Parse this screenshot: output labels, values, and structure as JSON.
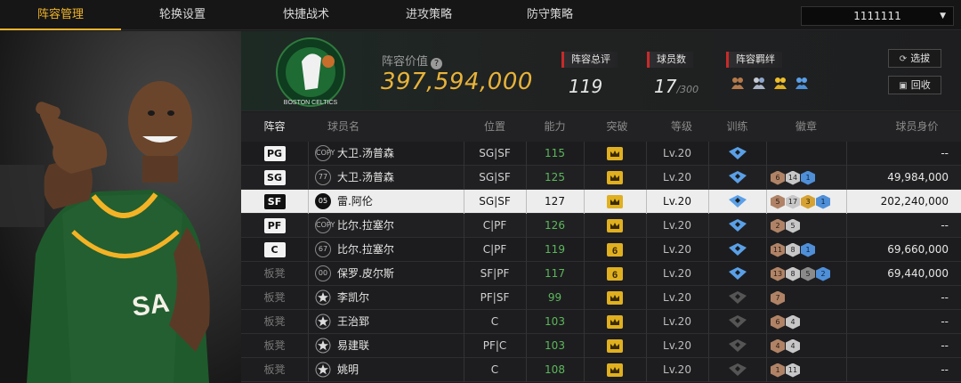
{
  "nav": {
    "tabs": [
      "阵容管理",
      "轮换设置",
      "快捷战术",
      "进攻策略",
      "防守策略"
    ],
    "active_index": 0,
    "account_select": "1111111"
  },
  "summary": {
    "value_label": "阵容价值",
    "value": "397,594,000",
    "overall_label": "阵容总评",
    "overall": "119",
    "players_label": "球员数",
    "players_count": "17",
    "players_max": "/300",
    "bond_label": "阵容羁绊",
    "bond_icons": [
      "bond-bronze-icon",
      "bond-silver-icon",
      "bond-gold-icon",
      "bond-blue-icon"
    ],
    "team_logo_text": "BOSTON CELTICS",
    "btn_select": "选拔",
    "btn_recycle": "回收"
  },
  "table": {
    "headers": [
      "阵容",
      "球员名",
      "位置",
      "能力",
      "突破",
      "等级",
      "训练",
      "徽章",
      "球员身价"
    ],
    "rows": [
      {
        "slot": "PG",
        "slot_type": "starter",
        "num": "COPY",
        "name": "大卫.汤普森",
        "pos": "SG|SF",
        "ability": "115",
        "breakthrough": "crown",
        "level": "Lv.20",
        "train": "blue",
        "badges": [],
        "price": "--"
      },
      {
        "slot": "SG",
        "slot_type": "starter",
        "num": "77",
        "name": "大卫.汤普森",
        "pos": "SG|SF",
        "ability": "125",
        "breakthrough": "crown",
        "level": "Lv.20",
        "train": "blue",
        "badges": [
          {
            "c": "bronze",
            "v": "6"
          },
          {
            "c": "silver",
            "v": "14"
          },
          {
            "c": "blue",
            "v": "1"
          }
        ],
        "price": "49,984,000"
      },
      {
        "slot": "SF",
        "slot_type": "starter",
        "num": "05",
        "name": "雷.阿伦",
        "pos": "SG|SF",
        "ability": "127",
        "breakthrough": "crown",
        "level": "Lv.20",
        "train": "blue",
        "badges": [
          {
            "c": "bronze",
            "v": "5"
          },
          {
            "c": "silver",
            "v": "17"
          },
          {
            "c": "gold",
            "v": "3"
          },
          {
            "c": "blue",
            "v": "1"
          }
        ],
        "price": "202,240,000",
        "selected": true
      },
      {
        "slot": "PF",
        "slot_type": "starter",
        "num": "COPY",
        "name": "比尔.拉塞尔",
        "pos": "C|PF",
        "ability": "126",
        "breakthrough": "crown",
        "level": "Lv.20",
        "train": "blue",
        "badges": [
          {
            "c": "bronze",
            "v": "2"
          },
          {
            "c": "silver",
            "v": "5"
          }
        ],
        "price": "--"
      },
      {
        "slot": "C",
        "slot_type": "starter",
        "num": "67",
        "name": "比尔.拉塞尔",
        "pos": "C|PF",
        "ability": "119",
        "breakthrough": "6",
        "level": "Lv.20",
        "train": "blue",
        "badges": [
          {
            "c": "bronze",
            "v": "11"
          },
          {
            "c": "silver",
            "v": "8"
          },
          {
            "c": "blue",
            "v": "1"
          }
        ],
        "price": "69,660,000"
      },
      {
        "slot": "板凳",
        "slot_type": "bench",
        "num": "00",
        "name": "保罗.皮尔斯",
        "pos": "SF|PF",
        "ability": "117",
        "breakthrough": "6",
        "level": "Lv.20",
        "train": "blue",
        "badges": [
          {
            "c": "bronze",
            "v": "13"
          },
          {
            "c": "silver",
            "v": "8"
          },
          {
            "c": "gray",
            "v": "5"
          },
          {
            "c": "blue",
            "v": "2"
          }
        ],
        "price": "69,440,000"
      },
      {
        "slot": "板凳",
        "slot_type": "bench",
        "num": "star",
        "name": "李凯尔",
        "pos": "PF|SF",
        "ability": "99",
        "breakthrough": "crown",
        "level": "Lv.20",
        "train": "gray",
        "badges": [
          {
            "c": "bronze",
            "v": "7"
          }
        ],
        "price": "--"
      },
      {
        "slot": "板凳",
        "slot_type": "bench",
        "num": "star",
        "name": "王治郅",
        "pos": "C",
        "ability": "103",
        "breakthrough": "crown",
        "level": "Lv.20",
        "train": "gray",
        "badges": [
          {
            "c": "bronze",
            "v": "6"
          },
          {
            "c": "silver",
            "v": "4"
          }
        ],
        "price": "--"
      },
      {
        "slot": "板凳",
        "slot_type": "bench",
        "num": "star",
        "name": "易建联",
        "pos": "PF|C",
        "ability": "103",
        "breakthrough": "crown",
        "level": "Lv.20",
        "train": "gray",
        "badges": [
          {
            "c": "bronze",
            "v": "4"
          },
          {
            "c": "silver",
            "v": "4"
          }
        ],
        "price": "--"
      },
      {
        "slot": "板凳",
        "slot_type": "bench",
        "num": "star",
        "name": "姚明",
        "pos": "C",
        "ability": "108",
        "breakthrough": "crown",
        "level": "Lv.20",
        "train": "gray",
        "badges": [
          {
            "c": "bronze",
            "v": "1"
          },
          {
            "c": "silver",
            "v": "11"
          }
        ],
        "price": "--"
      }
    ]
  },
  "colors": {
    "accent": "#f0b429",
    "ability_green": "#5cb85c",
    "stat_red": "#c82a2a",
    "value_gold": "#e8b33a"
  }
}
